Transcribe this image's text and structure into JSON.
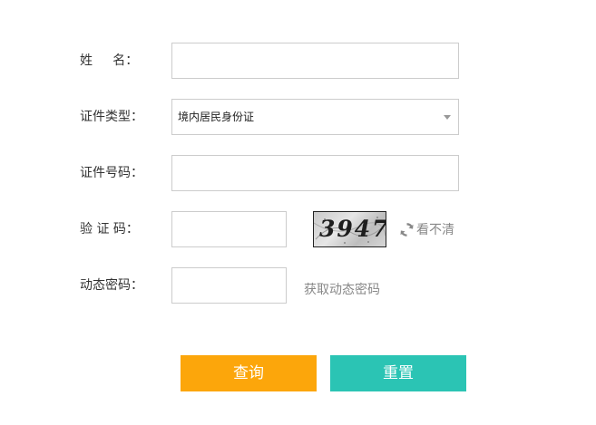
{
  "form": {
    "name_label": "姓     名：",
    "id_type_label": "证件类型：",
    "id_type_value": "境内居民身份证",
    "id_number_label": "证件号码：",
    "captcha_label": "验 证 码：",
    "captcha_text": "3947",
    "refresh_label": "看不清",
    "dynamic_code_label": "动态密码：",
    "get_dynamic_code_label": "获取动态密码"
  },
  "buttons": {
    "query_label": "查询",
    "reset_label": "重置"
  },
  "colors": {
    "query_button": "#fca60b",
    "reset_button": "#2bc4b4",
    "border": "#cccccc"
  },
  "icons": {
    "refresh": "refresh-icon",
    "dropdown": "chevron-down-icon"
  }
}
